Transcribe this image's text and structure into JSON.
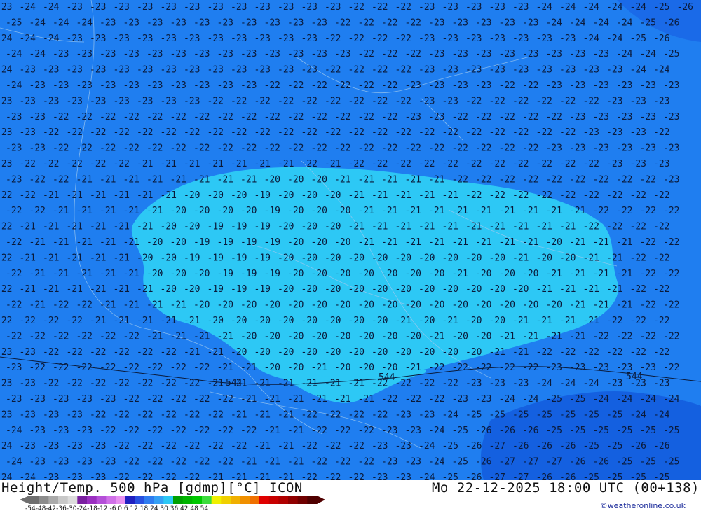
{
  "map": {
    "background_color": "#1f7ef0",
    "warm_region_color": "#2dc8f5",
    "warm_region_2_color": "#1fa8f0",
    "cold_region_color": "#1460e0",
    "contour_labels": [
      "544",
      "544",
      "544"
    ],
    "rows": [
      "23 24 24 23 23 23 23 23 23 23 23 23 23 23 23 22 22 22 23 23 23 23 23 24 24 24 24 24 25 26",
      "25 24 24 24 23 23 23 23 23 23 23 23 23 23 22 22 22 22 23 23 23 23 23 24 24 24 24 25 26",
      "24 24 24 23 23 23 23 23 23 23 23 23 23 23 22 22 22 22 23 23 23 23 23 23 23 24 24 25 26",
      "24 24 23 23 23 23 23 23 23 23 23 23 23 23 23 22 22 22 23 23 23 23 23 23 23 23 24 24 25",
      "24 23 23 23 23 23 23 23 23 23 23 23 23 23 22 22 22 22 23 23 23 23 23 23 23 23 23 24 24",
      "24 23 23 23 23 23 23 23 23 23 23 22 22 22 22 22 22 23 23 23 23 22 22 23 23 23 23 23 23",
      "23 23 23 23 23 23 23 23 23 22 22 22 22 22 22 22 22 22 23 23 22 22 22 22 22 22 23 23 23",
      "23 23 22 22 22 22 22 22 22 22 22 22 22 22 22 22 22 23 23 22 22 22 22 22 23 23 23 23 23",
      "23 23 22 22 22 22 22 22 22 22 22 22 22 22 22 22 22 22 22 22 22 22 22 22 22 23 23 23 22",
      "23 23 22 22 22 22 22 22 22 22 22 22 22 22 22 22 22 22 22 22 22 22 22 23 23 23 23 23 23",
      "23 22 22 22 22 22 21 21 21 21 21 21 21 22 21 22 22 22 22 22 22 22 22 22 22 22 23 23 23",
      "23 22 22 21 21 21 21 21 21 21 21 20 20 20 21 21 21 21 21 22 22 22 22 22 22 22 22 22 23",
      "22 22 21 21 21 21 21 21 20 20 20 19 20 20 20 21 21 21 21 21 22 22 22 22 22 22 22 22 22",
      "22 22 21 21 21 21 21 20 20 20 20 19 20 20 20 21 21 21 21 21 21 21 21 21 21 22 22 22 22",
      "22 21 21 21 21 21 21 20 20 19 19 19 20 20 20 21 21 21 21 21 21 21 21 21 21 22 22 22 22",
      "22 21 21 21 21 21 20 20 19 19 19 19 20 20 20 21 21 21 21 21 21 21 21 20 21 21 21 22 22",
      "22 21 21 21 21 21 20 20 19 19 19 19 20 20 20 20 20 20 20 20 20 20 21 20 20 21 21 22 22",
      "22 21 21 21 21 21 20 20 20 19 19 19 20 20 20 20 20 20 20 21 20 20 20 21 21 21 21 22 22",
      "22 21 21 21 21 21 21 20 20 19 19 19 20 20 20 20 20 20 20 20 20 20 20 21 21 21 21 22 22",
      "22 21 22 22 21 21 21 21 20 20 20 20 20 20 20 20 20 20 20 20 20 20 20 20 21 21 21 22 22",
      "22 22 22 22 21 21 21 21 21 20 20 20 20 20 20 20 20 21 20 21 20 20 21 21 21 21 22 22 22",
      "22 22 22 22 22 22 21 21 21 21 20 20 20 20 20 20 20 20 21 20 20 21 21 21 21 22 22 22 22",
      "23 23 22 22 22 22 22 22 21 21 20 20 20 20 20 20 20 20 20 20 20 21 21 22 22 22 22 22 22",
      "23 22 22 22 22 22 22 22 22 21 21 20 20 21 20 20 20 21 22 22 22 22 22 23 23 23 23 23 22",
      "23 23 22 22 22 22 22 22 22 21 21 21 21 21 21 21 22 22 22 22 23 23 23 24 24 24 23 23 23",
      "23 23 23 23 23 22 22 22 22 22 21 21 21 21 21 21 22 22 22 23 23 24 24 25 25 24 24 24 24",
      "23 23 23 23 22 22 22 22 22 22 21 21 21 22 22 22 22 23 23 24 25 25 25 25 25 25 25 24 24",
      "24 23 23 23 22 22 22 22 22 22 22 21 21 22 22 22 23 23 24 25 26 26 26 25 25 25 25 25 25",
      "24 23 23 23 23 22 22 22 22 22 22 21 21 22 22 22 23 23 24 25 26 27 26 26 26 25 25 26 26",
      "24 23 23 23 23 22 22 22 22 22 21 21 21 22 22 22 23 23 24 25 26 27 27 27 26 26 25 25 25",
      "24 24 23 23 23 22 22 22 22 21 21 21 21 22 22 22 23 23 24 25 26 27 27 26 26 25 25 25 25"
    ]
  },
  "footer": {
    "title": "Height/Temp. 500 hPa [gdmp][°C] ICON",
    "datetime": "Mo 22-12-2025 18:00 UTC (00+138)",
    "credit": "©weatheronline.co.uk",
    "scale_ticks": "-54-48-42-36-30-24-18-12 -6  0  6  12  18  24  30  36  42  48  54",
    "scale_colors": [
      "#6e6e6e",
      "#8c8c8c",
      "#aaaaaa",
      "#c8c8c8",
      "#dcdcdc",
      "#7a1fa0",
      "#9a2fc0",
      "#b44fd8",
      "#d070e8",
      "#e890f0",
      "#2020c0",
      "#2850e0",
      "#2f7cf0",
      "#35a0f5",
      "#2dc8f5",
      "#00a000",
      "#00b400",
      "#00c800",
      "#3cdc3c",
      "#f0f000",
      "#f0d000",
      "#f0b000",
      "#f09000",
      "#f07000",
      "#e00000",
      "#c80000",
      "#b00000",
      "#900000",
      "#700000",
      "#500000"
    ]
  }
}
